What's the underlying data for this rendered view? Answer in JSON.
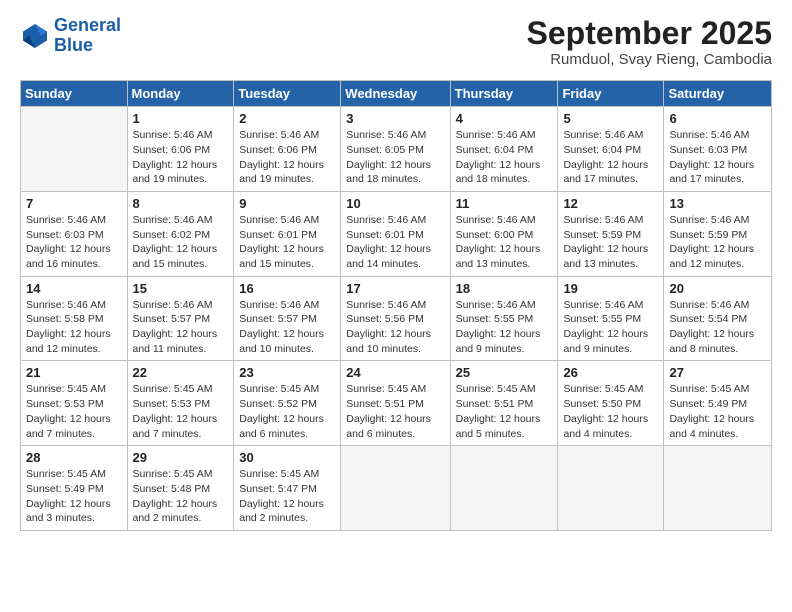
{
  "header": {
    "logo_line1": "General",
    "logo_line2": "Blue",
    "title": "September 2025",
    "subtitle": "Rumduol, Svay Rieng, Cambodia"
  },
  "weekdays": [
    "Sunday",
    "Monday",
    "Tuesday",
    "Wednesday",
    "Thursday",
    "Friday",
    "Saturday"
  ],
  "weeks": [
    [
      {
        "day": "",
        "info": ""
      },
      {
        "day": "1",
        "info": "Sunrise: 5:46 AM\nSunset: 6:06 PM\nDaylight: 12 hours\nand 19 minutes."
      },
      {
        "day": "2",
        "info": "Sunrise: 5:46 AM\nSunset: 6:06 PM\nDaylight: 12 hours\nand 19 minutes."
      },
      {
        "day": "3",
        "info": "Sunrise: 5:46 AM\nSunset: 6:05 PM\nDaylight: 12 hours\nand 18 minutes."
      },
      {
        "day": "4",
        "info": "Sunrise: 5:46 AM\nSunset: 6:04 PM\nDaylight: 12 hours\nand 18 minutes."
      },
      {
        "day": "5",
        "info": "Sunrise: 5:46 AM\nSunset: 6:04 PM\nDaylight: 12 hours\nand 17 minutes."
      },
      {
        "day": "6",
        "info": "Sunrise: 5:46 AM\nSunset: 6:03 PM\nDaylight: 12 hours\nand 17 minutes."
      }
    ],
    [
      {
        "day": "7",
        "info": "Sunrise: 5:46 AM\nSunset: 6:03 PM\nDaylight: 12 hours\nand 16 minutes."
      },
      {
        "day": "8",
        "info": "Sunrise: 5:46 AM\nSunset: 6:02 PM\nDaylight: 12 hours\nand 15 minutes."
      },
      {
        "day": "9",
        "info": "Sunrise: 5:46 AM\nSunset: 6:01 PM\nDaylight: 12 hours\nand 15 minutes."
      },
      {
        "day": "10",
        "info": "Sunrise: 5:46 AM\nSunset: 6:01 PM\nDaylight: 12 hours\nand 14 minutes."
      },
      {
        "day": "11",
        "info": "Sunrise: 5:46 AM\nSunset: 6:00 PM\nDaylight: 12 hours\nand 13 minutes."
      },
      {
        "day": "12",
        "info": "Sunrise: 5:46 AM\nSunset: 5:59 PM\nDaylight: 12 hours\nand 13 minutes."
      },
      {
        "day": "13",
        "info": "Sunrise: 5:46 AM\nSunset: 5:59 PM\nDaylight: 12 hours\nand 12 minutes."
      }
    ],
    [
      {
        "day": "14",
        "info": "Sunrise: 5:46 AM\nSunset: 5:58 PM\nDaylight: 12 hours\nand 12 minutes."
      },
      {
        "day": "15",
        "info": "Sunrise: 5:46 AM\nSunset: 5:57 PM\nDaylight: 12 hours\nand 11 minutes."
      },
      {
        "day": "16",
        "info": "Sunrise: 5:46 AM\nSunset: 5:57 PM\nDaylight: 12 hours\nand 10 minutes."
      },
      {
        "day": "17",
        "info": "Sunrise: 5:46 AM\nSunset: 5:56 PM\nDaylight: 12 hours\nand 10 minutes."
      },
      {
        "day": "18",
        "info": "Sunrise: 5:46 AM\nSunset: 5:55 PM\nDaylight: 12 hours\nand 9 minutes."
      },
      {
        "day": "19",
        "info": "Sunrise: 5:46 AM\nSunset: 5:55 PM\nDaylight: 12 hours\nand 9 minutes."
      },
      {
        "day": "20",
        "info": "Sunrise: 5:46 AM\nSunset: 5:54 PM\nDaylight: 12 hours\nand 8 minutes."
      }
    ],
    [
      {
        "day": "21",
        "info": "Sunrise: 5:45 AM\nSunset: 5:53 PM\nDaylight: 12 hours\nand 7 minutes."
      },
      {
        "day": "22",
        "info": "Sunrise: 5:45 AM\nSunset: 5:53 PM\nDaylight: 12 hours\nand 7 minutes."
      },
      {
        "day": "23",
        "info": "Sunrise: 5:45 AM\nSunset: 5:52 PM\nDaylight: 12 hours\nand 6 minutes."
      },
      {
        "day": "24",
        "info": "Sunrise: 5:45 AM\nSunset: 5:51 PM\nDaylight: 12 hours\nand 6 minutes."
      },
      {
        "day": "25",
        "info": "Sunrise: 5:45 AM\nSunset: 5:51 PM\nDaylight: 12 hours\nand 5 minutes."
      },
      {
        "day": "26",
        "info": "Sunrise: 5:45 AM\nSunset: 5:50 PM\nDaylight: 12 hours\nand 4 minutes."
      },
      {
        "day": "27",
        "info": "Sunrise: 5:45 AM\nSunset: 5:49 PM\nDaylight: 12 hours\nand 4 minutes."
      }
    ],
    [
      {
        "day": "28",
        "info": "Sunrise: 5:45 AM\nSunset: 5:49 PM\nDaylight: 12 hours\nand 3 minutes."
      },
      {
        "day": "29",
        "info": "Sunrise: 5:45 AM\nSunset: 5:48 PM\nDaylight: 12 hours\nand 2 minutes."
      },
      {
        "day": "30",
        "info": "Sunrise: 5:45 AM\nSunset: 5:47 PM\nDaylight: 12 hours\nand 2 minutes."
      },
      {
        "day": "",
        "info": ""
      },
      {
        "day": "",
        "info": ""
      },
      {
        "day": "",
        "info": ""
      },
      {
        "day": "",
        "info": ""
      }
    ]
  ]
}
